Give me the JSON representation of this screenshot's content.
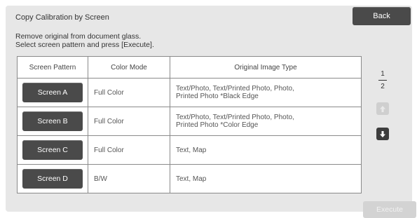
{
  "header": {
    "title": "Copy Calibration by Screen",
    "back_label": "Back"
  },
  "instructions": {
    "line1": "Remove original from document glass.",
    "line2": "Select screen pattern and press [Execute]."
  },
  "table": {
    "headers": [
      "Screen Pattern",
      "Color Mode",
      "Original Image Type"
    ],
    "rows": [
      {
        "button": "Screen A",
        "color_mode": "Full Color",
        "type_line1": "Text/Photo, Text/Printed Photo, Photo,",
        "type_line2": "Printed Photo *Black Edge"
      },
      {
        "button": "Screen B",
        "color_mode": "Full Color",
        "type_line1": "Text/Photo, Text/Printed Photo, Photo,",
        "type_line2": "Printed Photo *Color Edge"
      },
      {
        "button": "Screen C",
        "color_mode": "Full Color",
        "type_line1": "Text, Map",
        "type_line2": ""
      },
      {
        "button": "Screen D",
        "color_mode": "B/W",
        "type_line1": "Text, Map",
        "type_line2": ""
      }
    ]
  },
  "pager": {
    "current": "1",
    "total": "2",
    "up_icon": "arrow-up-icon",
    "down_icon": "arrow-down-icon"
  },
  "footer": {
    "execute_label": "Execute"
  }
}
